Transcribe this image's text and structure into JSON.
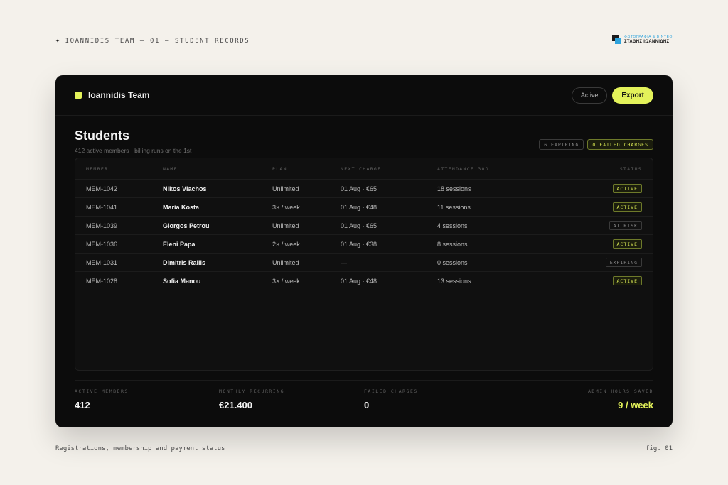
{
  "page": {
    "caption_top": "IOANNIDIS TEAM — 01 — STUDENT RECORDS",
    "caption_bottom": "Registrations, membership and payment status",
    "fig_label": "fig. 01"
  },
  "brand": {
    "line1": "ΦΩΤΟΓΡΑΦΙΑ & ΒΙΝΤΕΟ",
    "line2": "ΣΤΑΘΗΣ ΙΩΑΝΝΙΔΗΣ"
  },
  "header": {
    "team_name": "Ioannidis Team",
    "active_label": "Active",
    "export_label": "Export"
  },
  "section": {
    "title": "Students",
    "subtitle": "412 active members · billing runs on the 1st",
    "chip_expiring": "6 EXPIRING",
    "chip_failed": "0 FAILED CHARGES"
  },
  "table": {
    "columns": {
      "member": "MEMBER",
      "name": "NAME",
      "plan": "PLAN",
      "next": "NEXT CHARGE",
      "attendance": "ATTENDANCE 30D",
      "status": "STATUS"
    },
    "rows": [
      {
        "member": "MEM-1042",
        "name": "Nikos Vlachos",
        "plan": "Unlimited",
        "next": "01 Aug · €65",
        "attendance": "18 sessions",
        "status": "ACTIVE"
      },
      {
        "member": "MEM-1041",
        "name": "Maria Kosta",
        "plan": "3× / week",
        "next": "01 Aug · €48",
        "attendance": "11 sessions",
        "status": "ACTIVE"
      },
      {
        "member": "MEM-1039",
        "name": "Giorgos Petrou",
        "plan": "Unlimited",
        "next": "01 Aug · €65",
        "attendance": "4 sessions",
        "status": "AT RISK"
      },
      {
        "member": "MEM-1036",
        "name": "Eleni Papa",
        "plan": "2× / week",
        "next": "01 Aug · €38",
        "attendance": "8 sessions",
        "status": "ACTIVE"
      },
      {
        "member": "MEM-1031",
        "name": "Dimitris Rallis",
        "plan": "Unlimited",
        "next": "—",
        "attendance": "0 sessions",
        "status": "EXPIRING"
      },
      {
        "member": "MEM-1028",
        "name": "Sofia Manou",
        "plan": "3× / week",
        "next": "01 Aug · €48",
        "attendance": "13 sessions",
        "status": "ACTIVE"
      }
    ]
  },
  "stats": {
    "active_members": {
      "label": "ACTIVE MEMBERS",
      "value": "412"
    },
    "monthly_recurring": {
      "label": "MONTHLY RECURRING",
      "value": "€21.400"
    },
    "failed_charges": {
      "label": "FAILED CHARGES",
      "value": "0"
    },
    "admin_hours": {
      "label": "ADMIN HOURS SAVED",
      "value": "9 / week"
    }
  },
  "colors": {
    "accent": "#e3f25a",
    "panel": "#0c0c0c",
    "page": "#f4f1eb"
  }
}
